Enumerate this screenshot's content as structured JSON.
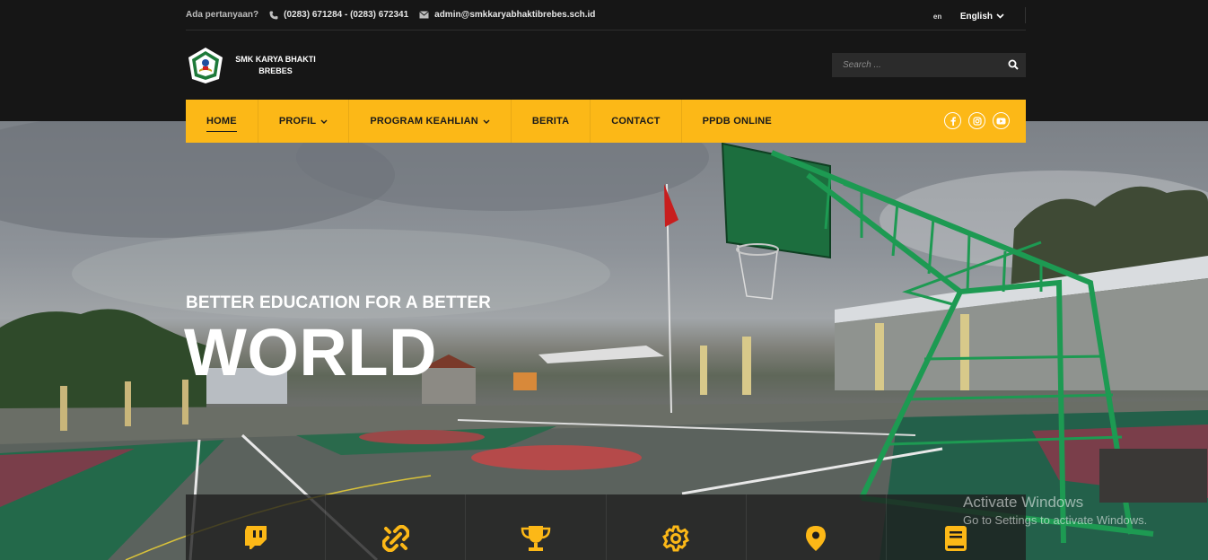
{
  "topbar": {
    "question_label": "Ada pertanyaan?",
    "phone": "(0283) 671284 - (0283) 672341",
    "email": "admin@smkkaryabhaktibrebes.sch.id",
    "language_flag_alt": "en",
    "language": "English"
  },
  "logo": {
    "line1": "SMK KARYA BHAKTI",
    "line2": "BREBES"
  },
  "search": {
    "placeholder": "Search ..."
  },
  "nav": {
    "items": [
      {
        "label": "HOME",
        "active": true
      },
      {
        "label": "PROFIL",
        "dropdown": true
      },
      {
        "label": "PROGRAM KEAHLIAN",
        "dropdown": true
      },
      {
        "label": "BERITA"
      },
      {
        "label": "CONTACT"
      },
      {
        "label": "PPDB ONLINE"
      }
    ],
    "social": [
      "facebook-icon",
      "instagram-icon",
      "youtube-icon"
    ]
  },
  "hero": {
    "tagline": "BETTER EDUCATION FOR A BETTER",
    "headline": "WORLD"
  },
  "features": [
    "twitch-icon",
    "link-broken-icon",
    "trophy-icon",
    "gear-icon",
    "map-marker-icon",
    "book-icon"
  ],
  "watermark": {
    "line1": "Activate Windows",
    "line2": "Go to Settings to activate Windows."
  },
  "colors": {
    "accent": "#fcb817",
    "header_bg": "#161616"
  }
}
